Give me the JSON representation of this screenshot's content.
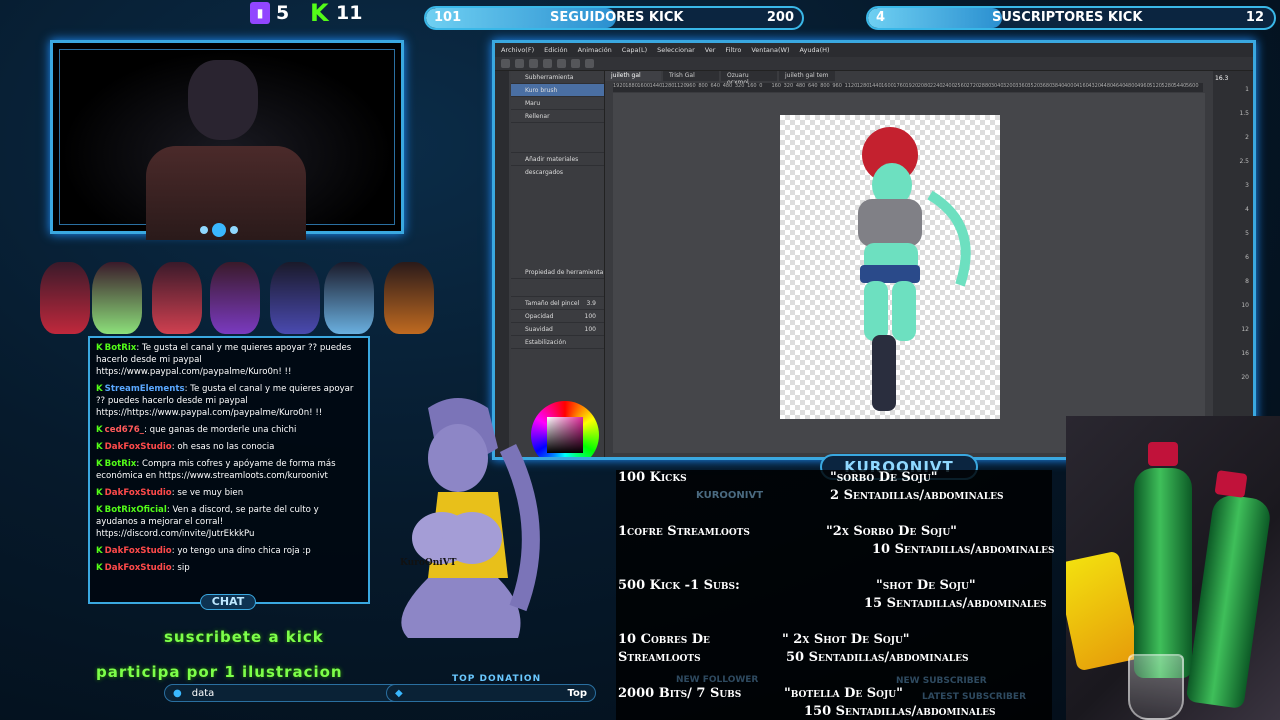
{
  "counters": {
    "twitch_count": "5",
    "kick_count": "11"
  },
  "goals_bar": {
    "followers": {
      "current": "101",
      "label": "SEGUIDORES KICK",
      "target": "200",
      "progress": 0.505
    },
    "subs": {
      "current": "4",
      "label": "SUSCRIPTORES KICK",
      "target": "12",
      "progress": 0.33
    }
  },
  "chat": {
    "title": "CHAT",
    "messages": [
      {
        "user": "BotRix",
        "user_color": "#53fc18",
        "text": ": Te gusta el canal y me quieres apoyar ?? puedes hacerlo desde mi paypal https://www.paypal.com/paypalme/Kuro0n! !!"
      },
      {
        "user": "StreamElements",
        "user_color": "#5aa8ff",
        "text": ": Te gusta el canal y me quieres apoyar ?? puedes hacerlo desde mi paypal https://https://www.paypal.com/paypalme/Kuro0n! !!"
      },
      {
        "user": "ced676_",
        "user_color": "#ff5a5a",
        "text": ": que ganas de morderle una chichi"
      },
      {
        "user": "DakFoxStudio",
        "user_color": "#ff4a4a",
        "text": ": oh esas no las conocia"
      },
      {
        "user": "BotRix",
        "user_color": "#53fc18",
        "text": ": Compra mis cofres y apóyame de forma más económica en https://www.streamloots.com/kuroonivt"
      },
      {
        "user": "DakFoxStudio",
        "user_color": "#ff4a4a",
        "text": ": se ve muy bien"
      },
      {
        "user": "BotRixOficial",
        "user_color": "#53fc18",
        "text": ": Ven a discord, se parte del culto y ayudanos a mejorar el corral! https://discord.com/invite/JutrEkkkPu"
      },
      {
        "user": "DakFoxStudio",
        "user_color": "#ff4a4a",
        "text": ": yo tengo una dino chica roja :p"
      },
      {
        "user": "DakFoxStudio",
        "user_color": "#ff4a4a",
        "text": ": sip"
      }
    ]
  },
  "promo": {
    "line1": "suscribete a kick",
    "line2": "participa por 1 ilustracion"
  },
  "bottom": {
    "search_value": "data",
    "top_donation": "TOP DONATION",
    "top_label": "Top"
  },
  "app": {
    "menu": [
      "Archivo(F)",
      "Edición",
      "Animación",
      "Capa(L)",
      "Seleccionar",
      "Ver",
      "Filtro",
      "Ventana(W)",
      "Ayuda(H)"
    ],
    "tabs": [
      "juileth gal",
      "Trish Gal",
      "Ozuaru ocxmol",
      "juileth gal tem"
    ],
    "subtool_header": "Subherramienta",
    "brushes": [
      "Kuro brush",
      "Maru",
      "Rellenar"
    ],
    "add_materials": "Añadir materiales descargados",
    "property_header": "Propiedad de herramienta",
    "brush_size_label": "Tamaño del pincel",
    "brush_size": "3.9",
    "opacity_label": "Opacidad",
    "opacity": "100",
    "smoothing_label": "Suavidad",
    "smoothing": "100",
    "stabilization_label": "Estabilización",
    "ruler_ticks": [
      "1920",
      "1880",
      "1600",
      "1440",
      "1280",
      "1120",
      "960",
      "800",
      "640",
      "480",
      "320",
      "160",
      "0",
      "160",
      "320",
      "480",
      "640",
      "800",
      "960",
      "1120",
      "1280",
      "1440",
      "1600",
      "1760",
      "1920",
      "2080",
      "2240",
      "2400",
      "2560",
      "2720",
      "2880",
      "3040",
      "3200",
      "3360",
      "3520",
      "3680",
      "3840",
      "4000",
      "4160",
      "4320",
      "4480",
      "4640",
      "4800",
      "4960",
      "5120",
      "5280",
      "5440",
      "5600"
    ],
    "right_ticks": [
      "1",
      "1.5",
      "2",
      "2.5",
      "3",
      "4",
      "5",
      "6",
      "8",
      "10",
      "12",
      "16",
      "20"
    ],
    "zoom": "16.3"
  },
  "channel_name": "KUROONIVT",
  "channel_name_small": "KUROONIVT",
  "goals": [
    {
      "left": "100 Kicks",
      "right1": "\"sorbo De Soju\"",
      "right2": "2 Sentadillas/abdominales"
    },
    {
      "left": "1cofre Streamloots",
      "right1": "\"2x Sorbo De Soju\"",
      "right2": "10 Sentadillas/abdominales"
    },
    {
      "left": "500 Kick -1 Subs:",
      "right1": "\"shot De Soju\"",
      "right2": "15 Sentadillas/abdominales"
    },
    {
      "left": "10 Cobres De",
      "left2": "Streamloots",
      "right1": "\" 2x Shot De Soju\"",
      "right2": "50 Sentadillas/abdominales"
    },
    {
      "left": "2000 Bits/ 7 Subs",
      "right1": "\"botella De Soju\"",
      "right2": "150 Sentadillas/abdominales"
    }
  ],
  "faint_labels": {
    "new_follower": "NEW FOLLOWER",
    "latest_subscriber": "LATEST SUBSCRIBER",
    "new_subscriber": "NEW SUBSCRIBER",
    "character_tag": "KuroOniVT"
  },
  "icons": [
    "twitch-icon",
    "kick-icon",
    "color-wheel-icon"
  ],
  "colors": {
    "accent": "#3aa8e0",
    "kick_green": "#53fc18",
    "twitch_purple": "#9146ff"
  }
}
